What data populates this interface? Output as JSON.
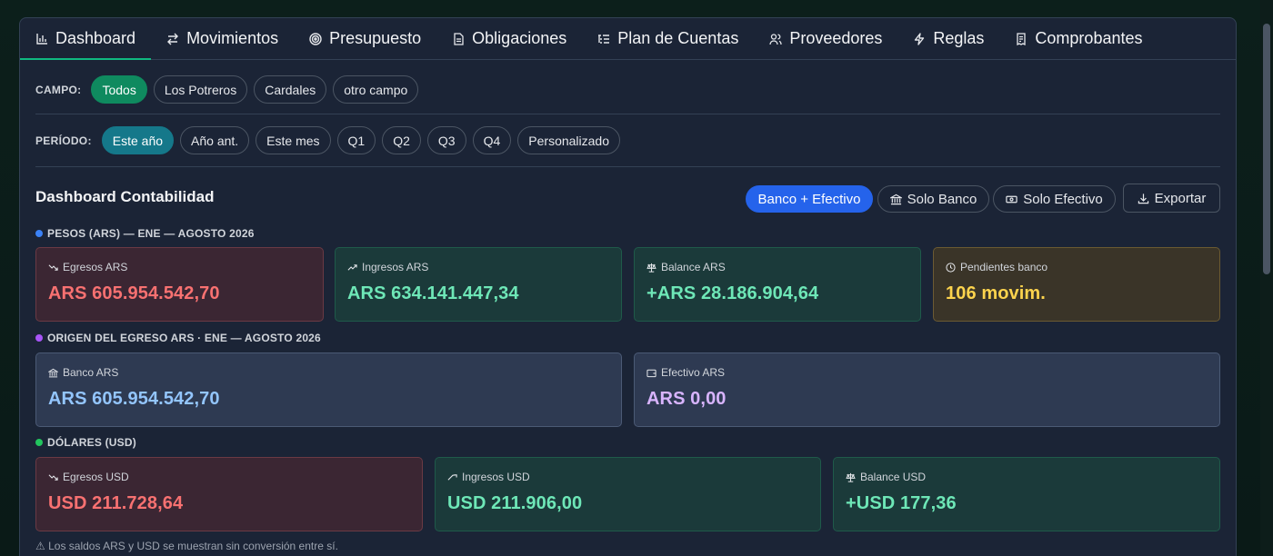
{
  "tabs": [
    {
      "label": "Dashboard",
      "icon": "bar-chart-icon",
      "active": true
    },
    {
      "label": "Movimientos",
      "icon": "transfer-arrows-icon"
    },
    {
      "label": "Presupuesto",
      "icon": "target-icon"
    },
    {
      "label": "Obligaciones",
      "icon": "document-icon"
    },
    {
      "label": "Plan de Cuentas",
      "icon": "list-tree-icon"
    },
    {
      "label": "Proveedores",
      "icon": "users-icon"
    },
    {
      "label": "Reglas",
      "icon": "lightning-icon"
    },
    {
      "label": "Comprobantes",
      "icon": "receipt-icon"
    }
  ],
  "campo": {
    "label": "CAMPO:",
    "options": [
      "Todos",
      "Los Potreros",
      "Cardales",
      "otro campo"
    ],
    "selected": "Todos"
  },
  "periodo": {
    "label": "PERÍODO:",
    "options": [
      "Este año",
      "Año ant.",
      "Este mes",
      "Q1",
      "Q2",
      "Q3",
      "Q4",
      "Personalizado"
    ],
    "selected": "Este año"
  },
  "header": {
    "title": "Dashboard Contabilidad",
    "mode_buttons": [
      "Banco + Efectivo",
      "Solo Banco",
      "Solo Efectivo"
    ],
    "mode_selected": "Banco + Efectivo",
    "export_label": "Exportar"
  },
  "sections": {
    "ars_label": "PESOS (ARS) — ENE — AGOSTO 2026",
    "origen_label": "ORIGEN DEL EGRESO ARS · ENE — AGOSTO 2026",
    "usd_label": "DÓLARES (USD)"
  },
  "ars_cards": {
    "egresos": {
      "label": "Egresos ARS",
      "value": "ARS 605.954.542,70"
    },
    "ingresos": {
      "label": "Ingresos ARS",
      "value": "ARS 634.141.447,34"
    },
    "balance": {
      "label": "Balance ARS",
      "value": "+ARS 28.186.904,64"
    },
    "pendientes": {
      "label": "Pendientes banco",
      "value": "106 movim."
    }
  },
  "origen_cards": {
    "banco": {
      "label": "Banco ARS",
      "value": "ARS 605.954.542,70"
    },
    "efectivo": {
      "label": "Efectivo ARS",
      "value": "ARS 0,00"
    }
  },
  "usd_cards": {
    "egresos": {
      "label": "Egresos USD",
      "value": "USD 211.728,64"
    },
    "ingresos": {
      "label": "Ingresos USD",
      "value": "USD 211.906,00"
    },
    "balance": {
      "label": "Balance USD",
      "value": "+USD 177,36"
    }
  },
  "note": "⚠ Los saldos ARS y USD se muestran sin conversión entre sí.",
  "colors": {
    "accent_green": "#10b981",
    "primary_blue": "#2563eb",
    "teal": "#15788a",
    "dot_ars": "#3b82f6",
    "dot_origen": "#a855f7",
    "dot_usd": "#22c55e"
  }
}
